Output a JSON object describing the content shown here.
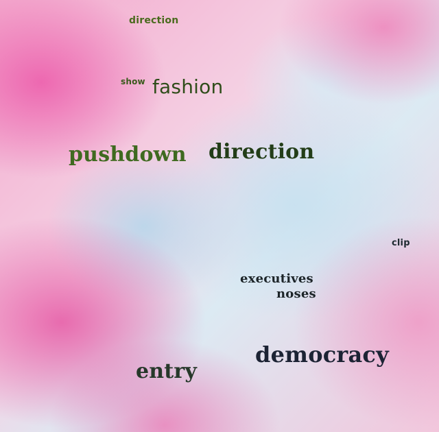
{
  "words": {
    "w1": "direction",
    "w2": "show",
    "w3": "fashion",
    "w4": "pushdown",
    "w5": "direction",
    "w6": "clip",
    "w7": "executives",
    "w8": "noses",
    "w9": "democracy",
    "w10": "entry"
  }
}
